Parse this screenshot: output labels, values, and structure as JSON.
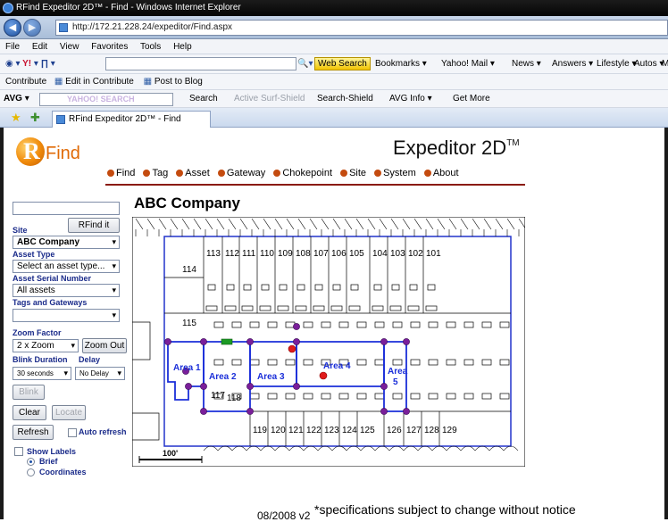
{
  "window": {
    "title": "RFind Expeditor 2D™ - Find - Windows Internet Explorer",
    "url": "http://172.21.228.24/expeditor/Find.aspx"
  },
  "menu": [
    "File",
    "Edit",
    "View",
    "Favorites",
    "Tools",
    "Help"
  ],
  "yahoo_toolbar": {
    "search_label": "Web Search",
    "items": [
      "Bookmarks ▾",
      "Yahoo! Mail ▾",
      "News ▾",
      "Answers ▾",
      "Lifestyle ▾",
      "Autos ▾",
      "M"
    ]
  },
  "contribute_toolbar": {
    "label": "Contribute",
    "edit": "Edit in Contribute",
    "post": "Post to Blog"
  },
  "avg_toolbar": {
    "avg": "AVG ▾",
    "search_placeholder": "YAHOO! SEARCH",
    "search": "Search",
    "active_shield": "Active Surf-Shield",
    "search_shield": "Search-Shield",
    "avg_info": "AVG Info ▾",
    "get_more": "Get More"
  },
  "tab": {
    "label": "RFind Expeditor 2D™ - Find"
  },
  "app": {
    "logo_r": "R",
    "logo_find": "Find",
    "title": "Expeditor 2D",
    "title_tm": "TM",
    "nav": [
      "Find",
      "Tag",
      "Asset",
      "Gateway",
      "Chokepoint",
      "Site",
      "System",
      "About"
    ],
    "company": "ABC Company"
  },
  "form": {
    "rfind_button": "RFind it",
    "site_label": "Site",
    "site_value": "ABC Company",
    "asset_type_label": "Asset Type",
    "asset_type_value": "Select an asset type...",
    "asset_serial_label": "Asset Serial Number",
    "asset_serial_value": "All assets",
    "tags_label": "Tags and Gateways",
    "tags_value": "",
    "zoom_label": "Zoom Factor",
    "zoom_value": "2 x Zoom",
    "zoom_out": "Zoom Out",
    "blink_duration_label": "Blink Duration",
    "delay_label": "Delay",
    "blink_duration_value": "30 seconds",
    "delay_value": "No Delay",
    "blink": "Blink",
    "clear": "Clear",
    "locate": "Locate",
    "refresh": "Refresh",
    "auto_refresh": "Auto refresh",
    "show_labels": "Show Labels",
    "brief": "Brief",
    "coordinates": "Coordinates"
  },
  "map": {
    "top_rooms": [
      "113",
      "112",
      "111",
      "110",
      "109",
      "108",
      "107",
      "106",
      "105",
      "104",
      "103",
      "102",
      "101"
    ],
    "left_rooms": [
      "114",
      "115",
      "117",
      "118"
    ],
    "bottom_rooms": [
      "119",
      "120",
      "121",
      "122",
      "123",
      "124",
      "125",
      "126",
      "127",
      "128",
      "129"
    ],
    "areas": [
      "Area 1",
      "Area 2",
      "Area 3",
      "Area 4",
      "Area 5"
    ],
    "scale": "100'"
  },
  "footer": {
    "version": "08/2008 v2",
    "disclaimer": "*specifications subject to change without notice"
  },
  "colors": {
    "accent": "#e06a05",
    "nav_bullet": "#c44b0f",
    "label_blue": "#1a2b8a",
    "area_line": "#1b2fd9",
    "gateway_node": "#7a1f9a",
    "tag_red": "#e01b1b"
  }
}
